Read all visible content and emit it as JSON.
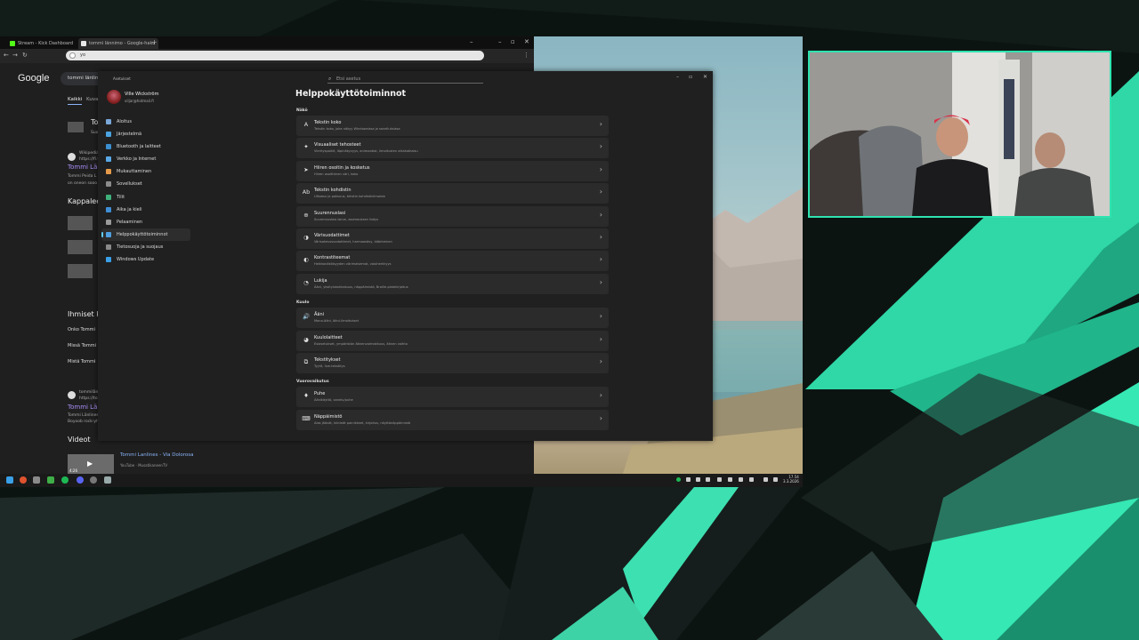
{
  "browser": {
    "tabs": [
      {
        "label": "Stream - Kick Dashboard"
      },
      {
        "label": "tommi lännimo - Google-haku"
      }
    ],
    "new_tab": "+",
    "url": "yo",
    "google": {
      "logo": "Google",
      "query": "tommi länlinen",
      "tab_all": "Kaikki",
      "tab_other": "Kuvat",
      "result_title_short": "To",
      "result_sub_short": "Suo",
      "wiki_source": "Wikipedia",
      "wiki_url": "https://fi.wi",
      "wiki_link": "Tommi Län",
      "wiki_snippet1": "Tommi Peida L",
      "wiki_snippet2": "on oneon sooo",
      "songs_heading": "Kappaleet",
      "people_heading": "Ihmiset ky",
      "q1": "Onko Tommi",
      "q2": "Missä Tommi",
      "q3": "Mistä Tommi",
      "r2_source": "tommilän",
      "r2_url": "https://tom",
      "r2_link": "Tommi Län",
      "r2_snippet1": "Tommi Länlines",
      "r2_snippet2": "Boyoob rock-yh",
      "videos_heading": "Videot",
      "video_title": "Tommi Lanlines - Via Dolorosa",
      "video_meta": "YouTube · MusatikaneenTV",
      "video_duration": "4:26"
    }
  },
  "settings": {
    "app_title": "Asetukset",
    "search_placeholder": "Etsi asetus",
    "user": {
      "name": "Ville Wickström",
      "email": "viljar@hotmail.fi"
    },
    "nav": [
      {
        "label": "Aloitus",
        "icon": "home-icon",
        "color": "#7aa7d8"
      },
      {
        "label": "Järjestelmä",
        "icon": "system-icon",
        "color": "#4aa3df"
      },
      {
        "label": "Bluetooth ja laitteet",
        "icon": "bluetooth-icon",
        "color": "#3b8ed0"
      },
      {
        "label": "Verkko ja Internet",
        "icon": "network-icon",
        "color": "#5aa9e6"
      },
      {
        "label": "Mukauttaminen",
        "icon": "brush-icon",
        "color": "#e59a4a"
      },
      {
        "label": "Sovellukset",
        "icon": "apps-icon",
        "color": "#8c8c8c"
      },
      {
        "label": "Tilit",
        "icon": "account-icon",
        "color": "#3fb07a"
      },
      {
        "label": "Aika ja kieli",
        "icon": "globe-clock-icon",
        "color": "#3f8fd6"
      },
      {
        "label": "Pelaaminen",
        "icon": "gamepad-icon",
        "color": "#9a9a9a"
      },
      {
        "label": "Helppokäyttötoiminnot",
        "icon": "accessibility-icon",
        "color": "#4fa0e0",
        "active": true
      },
      {
        "label": "Tietosuoja ja suojaus",
        "icon": "shield-icon",
        "color": "#8a8a8a"
      },
      {
        "label": "Windows Update",
        "icon": "update-icon",
        "color": "#3aa0e8"
      }
    ],
    "page_title": "Helppokäyttötoiminnot",
    "sections": [
      {
        "title": "Näkö",
        "items": [
          {
            "icon": "text-size-icon",
            "glyph": "A",
            "title": "Tekstin koko",
            "subtitle": "Tekstin koko, joka näkyy Windowsissa ja sovelluksissa"
          },
          {
            "icon": "sparkle-icon",
            "glyph": "✦",
            "title": "Visuaaliset tehosteet",
            "subtitle": "Vierityspalkit, läpinäkyvyys, animaatiot, ilmoitusten aikakatkaisu"
          },
          {
            "icon": "mouse-pointer-icon",
            "glyph": "➤",
            "title": "Hiiren osoitin ja kosketus",
            "subtitle": "Hiiren osoittimen väri, koko"
          },
          {
            "icon": "text-cursor-icon",
            "glyph": "Ab",
            "title": "Tekstin kohdistin",
            "subtitle": "Ulkoasu ja paksuus, tekstin kohdistinilmaisin"
          },
          {
            "icon": "magnifier-icon",
            "glyph": "⊕",
            "title": "Suurennuslasi",
            "subtitle": "Suurennuslasi-tarve, zoomauksen lisäys"
          },
          {
            "icon": "color-filter-icon",
            "glyph": "◑",
            "title": "Värisuodattimet",
            "subtitle": "Värisokeussuodattimet, harmaasävy, käänteinen"
          },
          {
            "icon": "contrast-icon",
            "glyph": "◐",
            "title": "Kontrastiteemat",
            "subtitle": "Heikkonäköisyyden värimaisemat, valoherkkyys"
          },
          {
            "icon": "narrator-icon",
            "glyph": "◔",
            "title": "Lukija",
            "subtitle": "Ääni, yksityiskohtaisuus, näppäimistö, Braille-pistekirjoitus"
          }
        ]
      },
      {
        "title": "Kuulo",
        "items": [
          {
            "icon": "speaker-icon",
            "glyph": "🔊",
            "title": "Ääni",
            "subtitle": "Mono-ääni, ääni-ilmoitukset"
          },
          {
            "icon": "hearing-icon",
            "glyph": "◕",
            "title": "Kuulolaitteet",
            "subtitle": "Esiasetukset, ympäristön äänenvoimakkuus, äänen vaihto"
          },
          {
            "icon": "captions-icon",
            "glyph": "⧉",
            "title": "Tekstitykset",
            "subtitle": "Tyylit, live-tekstitys"
          }
        ]
      },
      {
        "title": "Vuorovaikutus",
        "items": [
          {
            "icon": "microphone-icon",
            "glyph": "♦",
            "title": "Puhe",
            "subtitle": "Äänikäyttö, sanelu/puhe"
          },
          {
            "icon": "keyboard-icon",
            "glyph": "⌨",
            "title": "Näppäimistö",
            "subtitle": "Alas jäävät, kiinteät painikkeet, kirjoitus, näyttönäppäimistö"
          }
        ]
      }
    ]
  },
  "taskbar": {
    "time": "17.54",
    "date": "3.3.2026"
  },
  "colors": {
    "accent": "#2ee3b0",
    "settings_bg": "#202020",
    "row_bg": "#2b2b2b"
  }
}
